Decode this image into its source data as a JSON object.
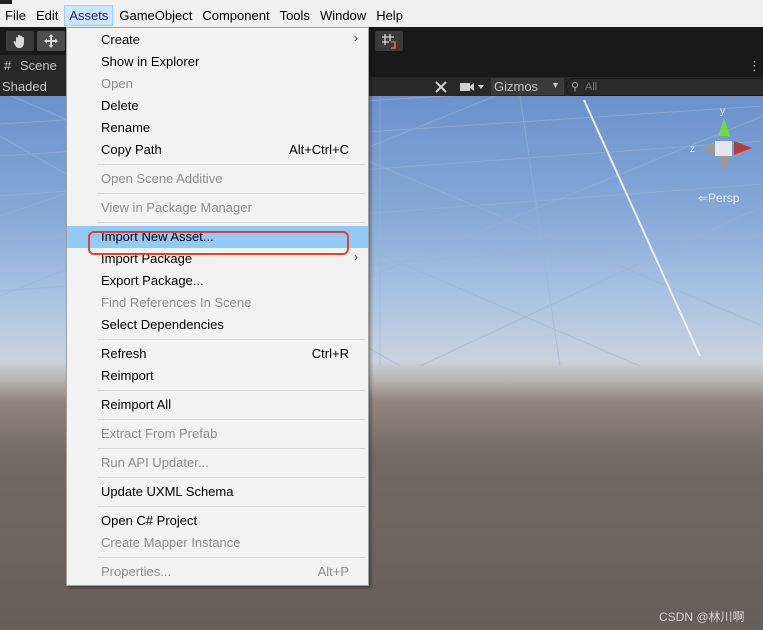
{
  "menubar": {
    "items": [
      "File",
      "Edit",
      "Assets",
      "GameObject",
      "Component",
      "Tools",
      "Window",
      "Help"
    ],
    "active": "Assets"
  },
  "toolbar": {
    "tools": [
      "hand-tool-icon",
      "move-tool-icon",
      "snap-grid-icon"
    ]
  },
  "scene_tab": {
    "label": "Scene",
    "icon": "hash-icon"
  },
  "scene_toolbar": {
    "shading_mode": "Shaded",
    "gizmos_label": "Gizmos",
    "search_placeholder": "All"
  },
  "viewport": {
    "persp_label": "⇐Persp",
    "orientation_axes": [
      "y",
      "z"
    ]
  },
  "assets_menu": {
    "items": [
      {
        "label": "Create",
        "shortcut": "",
        "submenu": true,
        "enabled": true
      },
      {
        "label": "Show in Explorer",
        "shortcut": "",
        "submenu": false,
        "enabled": true
      },
      {
        "label": "Open",
        "shortcut": "",
        "submenu": false,
        "enabled": false
      },
      {
        "label": "Delete",
        "shortcut": "",
        "submenu": false,
        "enabled": true
      },
      {
        "label": "Rename",
        "shortcut": "",
        "submenu": false,
        "enabled": true
      },
      {
        "label": "Copy Path",
        "shortcut": "Alt+Ctrl+C",
        "submenu": false,
        "enabled": true
      },
      {
        "label": "Open Scene Additive",
        "shortcut": "",
        "submenu": false,
        "enabled": false
      },
      {
        "label": "View in Package Manager",
        "shortcut": "",
        "submenu": false,
        "enabled": false
      },
      {
        "label": "Import New Asset...",
        "shortcut": "",
        "submenu": false,
        "enabled": true,
        "highlighted": true
      },
      {
        "label": "Import Package",
        "shortcut": "",
        "submenu": true,
        "enabled": true
      },
      {
        "label": "Export Package...",
        "shortcut": "",
        "submenu": false,
        "enabled": true
      },
      {
        "label": "Find References In Scene",
        "shortcut": "",
        "submenu": false,
        "enabled": false
      },
      {
        "label": "Select Dependencies",
        "shortcut": "",
        "submenu": false,
        "enabled": true
      },
      {
        "label": "Refresh",
        "shortcut": "Ctrl+R",
        "submenu": false,
        "enabled": true
      },
      {
        "label": "Reimport",
        "shortcut": "",
        "submenu": false,
        "enabled": true
      },
      {
        "label": "Reimport All",
        "shortcut": "",
        "submenu": false,
        "enabled": true
      },
      {
        "label": "Extract From Prefab",
        "shortcut": "",
        "submenu": false,
        "enabled": false
      },
      {
        "label": "Run API Updater...",
        "shortcut": "",
        "submenu": false,
        "enabled": false
      },
      {
        "label": "Update UXML Schema",
        "shortcut": "",
        "submenu": false,
        "enabled": true
      },
      {
        "label": "Open C# Project",
        "shortcut": "",
        "submenu": false,
        "enabled": true
      },
      {
        "label": "Create Mapper Instance",
        "shortcut": "",
        "submenu": false,
        "enabled": false
      },
      {
        "label": "Properties...",
        "shortcut": "Alt+P",
        "submenu": false,
        "enabled": false
      }
    ]
  },
  "watermark": "CSDN @林川啊",
  "colors": {
    "menu_highlight": "#91c9f7",
    "annotation_outline": "#e0432f",
    "menubar_active": "#cce8ff"
  }
}
